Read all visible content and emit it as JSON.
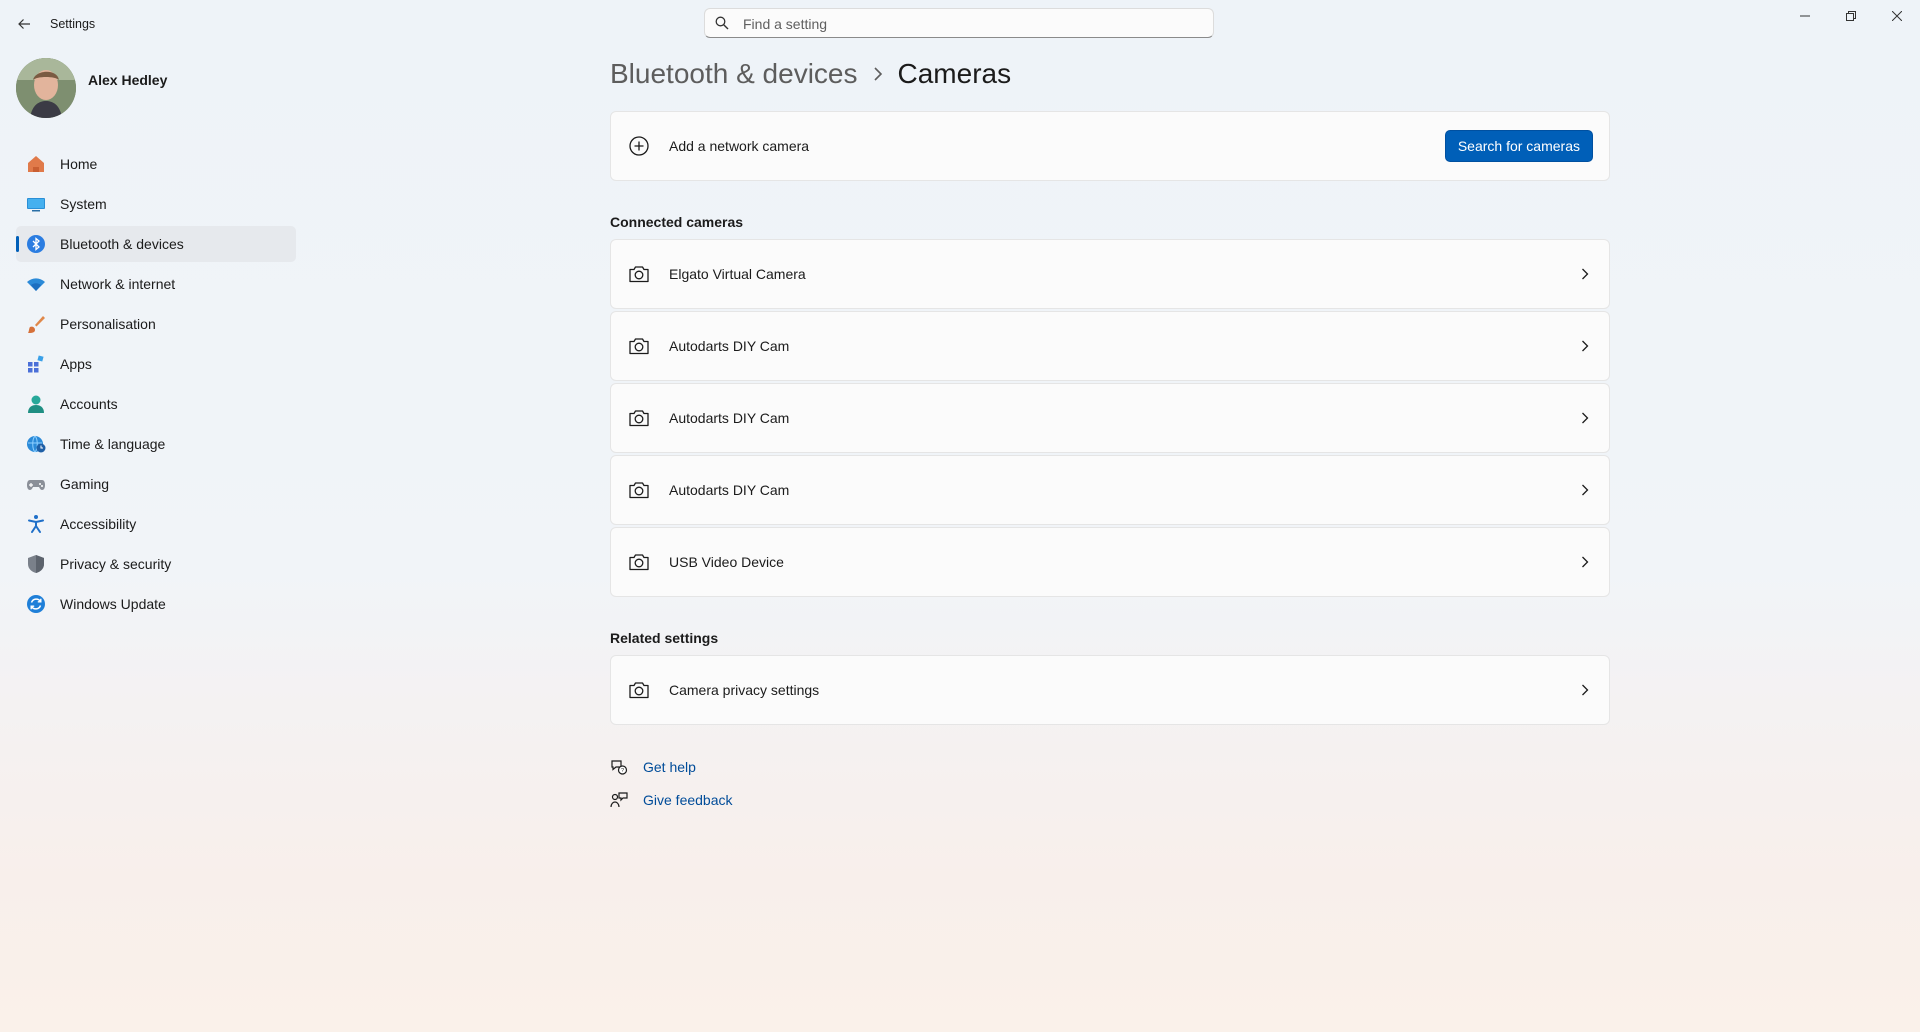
{
  "window": {
    "title": "Settings",
    "controls": [
      "minimize-icon",
      "restore-icon",
      "close-icon"
    ]
  },
  "search": {
    "placeholder": "Find a setting",
    "value": ""
  },
  "user": {
    "name": "Alex Hedley"
  },
  "sidebar": {
    "items": [
      {
        "label": "Home",
        "icon": "home-icon"
      },
      {
        "label": "System",
        "icon": "system-icon"
      },
      {
        "label": "Bluetooth & devices",
        "icon": "bluetooth-icon",
        "selected": true
      },
      {
        "label": "Network & internet",
        "icon": "wifi-icon"
      },
      {
        "label": "Personalisation",
        "icon": "brush-icon"
      },
      {
        "label": "Apps",
        "icon": "apps-icon"
      },
      {
        "label": "Accounts",
        "icon": "accounts-icon"
      },
      {
        "label": "Time & language",
        "icon": "globe-clock-icon"
      },
      {
        "label": "Gaming",
        "icon": "gamepad-icon"
      },
      {
        "label": "Accessibility",
        "icon": "accessibility-icon"
      },
      {
        "label": "Privacy & security",
        "icon": "shield-icon"
      },
      {
        "label": "Windows Update",
        "icon": "update-icon"
      }
    ]
  },
  "breadcrumb": {
    "parent": "Bluetooth & devices",
    "current": "Cameras"
  },
  "add_camera": {
    "label": "Add a network camera",
    "button": "Search for cameras"
  },
  "connected": {
    "heading": "Connected cameras",
    "cameras": [
      {
        "name": "Elgato Virtual Camera"
      },
      {
        "name": "Autodarts DIY Cam"
      },
      {
        "name": "Autodarts DIY Cam"
      },
      {
        "name": "Autodarts DIY Cam"
      },
      {
        "name": "USB Video Device"
      }
    ]
  },
  "related": {
    "heading": "Related settings",
    "items": [
      {
        "label": "Camera privacy settings"
      }
    ]
  },
  "help": {
    "get_help": "Get help",
    "give_feedback": "Give feedback"
  },
  "colors": {
    "accent": "#005fb8",
    "link": "#004c99"
  }
}
